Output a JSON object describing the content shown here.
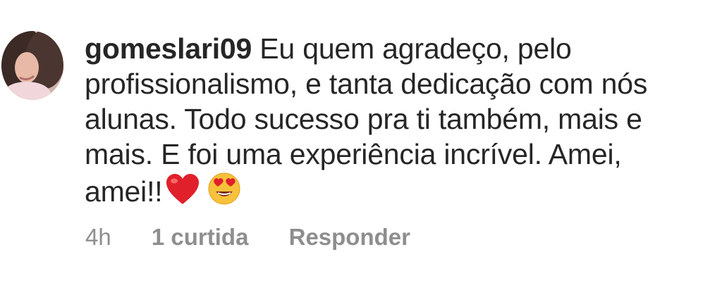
{
  "comment": {
    "username": "gomeslari09",
    "text_lines": [
      " Eu quem agradeço, pelo",
      "profissionalismo, e tanta dedicação com nós",
      "alunas. Todo sucesso pra ti também, mais e",
      "mais. E foi uma experiência incrível. Amei,",
      "amei!!"
    ],
    "emojis": [
      "red-heart",
      "heart-eyes-face"
    ],
    "time": "4h",
    "likes": "1 curtida",
    "reply_label": "Responder"
  }
}
